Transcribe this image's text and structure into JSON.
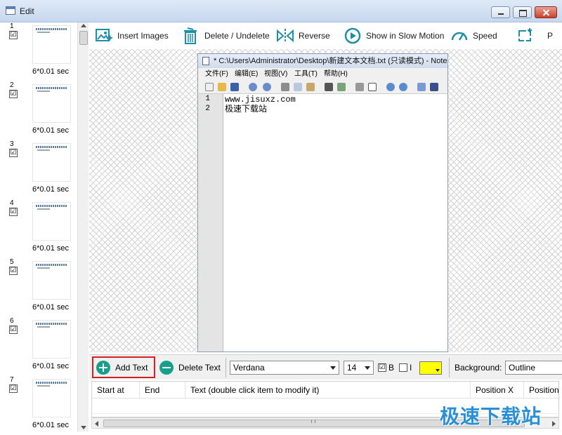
{
  "window": {
    "title": "Edit"
  },
  "frames": [
    {
      "number": "1",
      "checked": "☑",
      "duration": "6*0.01 sec"
    },
    {
      "number": "2",
      "checked": "☑",
      "duration": "6*0.01 sec"
    },
    {
      "number": "3",
      "checked": "☑",
      "duration": "6*0.01 sec"
    },
    {
      "number": "4",
      "checked": "☑",
      "duration": "6*0.01 sec"
    },
    {
      "number": "5",
      "checked": "☑",
      "duration": "6*0.01 sec"
    },
    {
      "number": "6",
      "checked": "☑",
      "duration": "6*0.01 sec"
    },
    {
      "number": "7",
      "checked": "☑",
      "duration": "6*0.01 sec"
    }
  ],
  "toolbar": {
    "insert_images": "Insert Images",
    "delete_undelete": "Delete / Undelete",
    "reverse": "Reverse",
    "slow_motion": "Show in Slow Motion",
    "speed": "Speed",
    "partial": "P"
  },
  "notepad": {
    "title": "* C:\\Users\\Administrator\\Desktop\\新建文本文档.txt (只读模式) - Notepad++",
    "menu": [
      "文件(F)",
      "编辑(E)",
      "视图(V)",
      "工具(T)",
      "帮助(H)"
    ],
    "lines": [
      {
        "num": "1",
        "text": "www.jisuxz.com"
      },
      {
        "num": "2",
        "text": "极速下载站"
      }
    ]
  },
  "text_options": {
    "add_text": "Add Text",
    "delete_text": "Delete Text",
    "font": "Verdana",
    "size": "14",
    "bold_checked": "☑",
    "bold_label": "B",
    "italic_checked": "",
    "italic_label": "I",
    "color": "#ffff00",
    "background_label": "Background:",
    "background_value": "Outline"
  },
  "table": {
    "columns": [
      "Start at",
      "End",
      "Text (double click item to modify it)",
      "Position X",
      "Position"
    ]
  },
  "watermark": "极速下载站",
  "colors": {
    "accent": "#16a08c",
    "highlight_border": "#d42020",
    "watermark": "#2b8fd6"
  }
}
